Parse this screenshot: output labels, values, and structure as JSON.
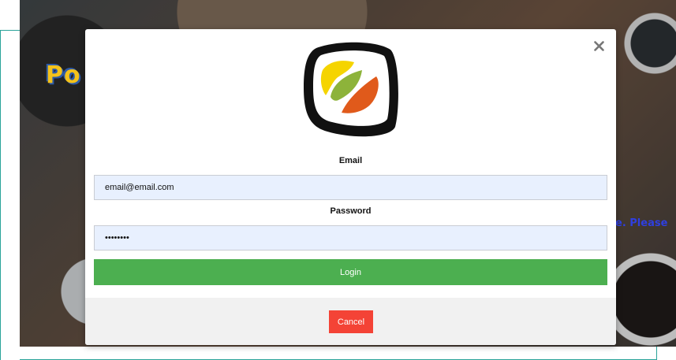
{
  "background": {
    "brand_text": "Po",
    "side_text": "e. Please"
  },
  "modal": {
    "close_icon": "close-icon",
    "logo_icon": "sushi-roll-logo-icon",
    "email_label": "Email",
    "email_value": "email@email.com",
    "password_label": "Password",
    "password_value": "••••••••",
    "login_label": "Login",
    "cancel_label": "Cancel"
  },
  "colors": {
    "login": "#4caf50",
    "cancel": "#f44336",
    "input_bg": "#e8f0fe",
    "footer_bg": "#f1f1f1"
  }
}
